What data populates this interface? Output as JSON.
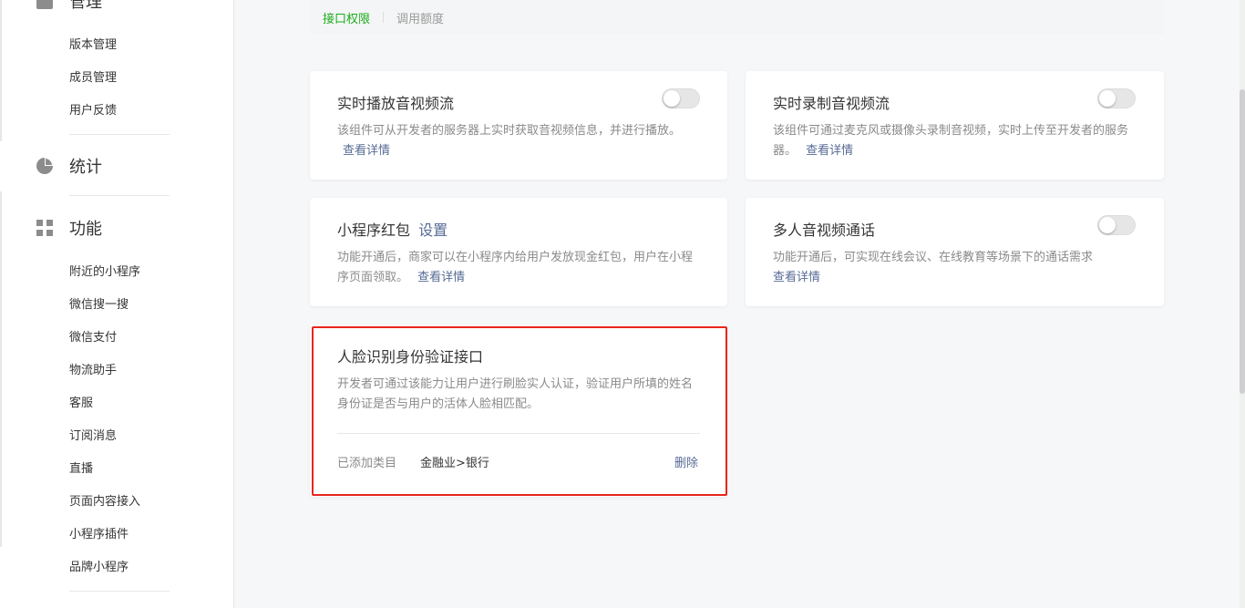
{
  "sidebar": {
    "manage_section": {
      "label": "管理",
      "icon": "grid-box-icon"
    },
    "manage_items": [
      "版本管理",
      "成员管理",
      "用户反馈"
    ],
    "stats_section": {
      "label": "统计",
      "icon": "pie-chart-icon"
    },
    "func_section": {
      "label": "功能",
      "icon": "four-squares-icon"
    },
    "func_items": [
      "附近的小程序",
      "微信搜一搜",
      "微信支付",
      "物流助手",
      "客服",
      "订阅消息",
      "直播",
      "页面内容接入",
      "小程序插件",
      "品牌小程序"
    ]
  },
  "tabs": {
    "active": "接口权限",
    "inactive": "调用额度"
  },
  "cards": {
    "live_play": {
      "title": "实时播放音视频流",
      "desc": "该组件可从开发者的服务器上实时获取音视频信息，并进行播放。",
      "link": "查看详情"
    },
    "live_record": {
      "title": "实时录制音视频流",
      "desc": "该组件可通过麦克风或摄像头录制音视频，实时上传至开发者的服务器。",
      "link": "查看详情"
    },
    "red_packet": {
      "title": "小程序红包",
      "title_link": "设置",
      "desc": "功能开通后，商家可以在小程序内给用户发放现金红包，用户在小程序页面领取。",
      "link": "查看详情"
    },
    "multi_call": {
      "title": "多人音视频通话",
      "desc": "功能开通后，可实现在线会议、在线教育等场景下的通话需求",
      "link": "查看详情"
    },
    "face_id": {
      "title": "人脸识别身份验证接口",
      "desc": "开发者可通过该能力让用户进行刷脸实人认证，验证用户所填的姓名身份证是否与用户的活体人脸相匹配。",
      "category_label": "已添加类目",
      "category_value": "金融业>银行",
      "delete_label": "删除"
    }
  },
  "toggles": {
    "live_play": false,
    "live_record": false,
    "multi_call": false
  },
  "colors": {
    "accent_green": "#1aad19",
    "link_blue": "#576b95",
    "highlight_red": "#e8251d"
  }
}
